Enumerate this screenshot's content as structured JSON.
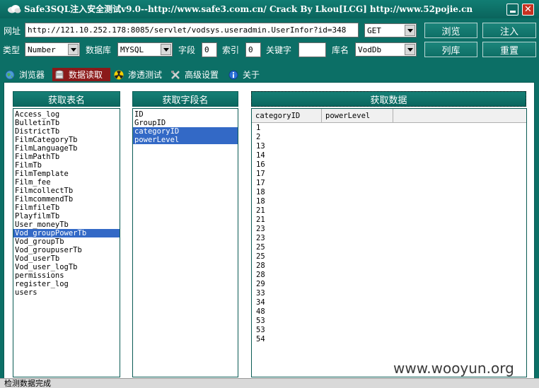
{
  "window": {
    "title": "Safe3SQL注入安全测试v9.0--http://www.safe3.com.cn/   Crack By Lkou[LCG]  http://www.52pojie.cn"
  },
  "toolbar": {
    "url_label": "网址",
    "url_value": "http://121.10.252.178:8085/servlet/vodsys.useradmin.UserInfor?id=348",
    "method": "GET",
    "browse_button": "浏览",
    "inject_button": "注入",
    "type_label": "类型",
    "type_value": "Number",
    "db_label": "数据库",
    "db_value": "MYSQL",
    "field_label": "字段",
    "field_value": "0",
    "index_label": "索引",
    "index_value": "0",
    "keyword_label": "关键字",
    "keyword_value": "",
    "libname_label": "库名",
    "libname_value": "VodDb",
    "list_db_button": "列库",
    "reset_button": "重置"
  },
  "tabs": [
    {
      "label": "浏览器",
      "icon": "globe-icon",
      "active": false
    },
    {
      "label": "数据读取",
      "icon": "database-icon",
      "active": true
    },
    {
      "label": "渗透测试",
      "icon": "radiation-icon",
      "active": false
    },
    {
      "label": "高级设置",
      "icon": "tools-icon",
      "active": false
    },
    {
      "label": "关于",
      "icon": "info-icon",
      "active": false
    }
  ],
  "panels": {
    "tables_header": "获取表名",
    "fields_header": "获取字段名",
    "data_header": "获取数据"
  },
  "tables": [
    {
      "name": "Access_log",
      "selected": false
    },
    {
      "name": "BulletinTb",
      "selected": false
    },
    {
      "name": "DistrictTb",
      "selected": false
    },
    {
      "name": "FilmCategoryTb",
      "selected": false
    },
    {
      "name": "FilmLanguageTb",
      "selected": false
    },
    {
      "name": "FilmPathTb",
      "selected": false
    },
    {
      "name": "FilmTb",
      "selected": false
    },
    {
      "name": "FilmTemplate",
      "selected": false
    },
    {
      "name": "Film_fee",
      "selected": false
    },
    {
      "name": "FilmcollectTb",
      "selected": false
    },
    {
      "name": "FilmcommendTb",
      "selected": false
    },
    {
      "name": "FilmfileTb",
      "selected": false
    },
    {
      "name": "PlayfilmTb",
      "selected": false
    },
    {
      "name": "User_moneyTb",
      "selected": false
    },
    {
      "name": "Vod_groupPowerTb",
      "selected": true
    },
    {
      "name": "Vod_groupTb",
      "selected": false
    },
    {
      "name": "Vod_groupuserTb",
      "selected": false
    },
    {
      "name": "Vod_userTb",
      "selected": false
    },
    {
      "name": "Vod_user_logTb",
      "selected": false
    },
    {
      "name": "permissions",
      "selected": false
    },
    {
      "name": "register_log",
      "selected": false
    },
    {
      "name": "users",
      "selected": false
    }
  ],
  "fields": [
    {
      "name": "ID",
      "selected": false
    },
    {
      "name": "GroupID",
      "selected": false
    },
    {
      "name": "categoryID",
      "selected": true
    },
    {
      "name": "powerLevel",
      "selected": true
    }
  ],
  "data_grid": {
    "columns": [
      "categoryID",
      "powerLevel"
    ],
    "rows": [
      "1",
      "2",
      "13",
      "14",
      "16",
      "17",
      "17",
      "18",
      "18",
      "21",
      "21",
      "23",
      "23",
      "25",
      "25",
      "28",
      "28",
      "29",
      "33",
      "34",
      "48",
      "53",
      "53",
      "54"
    ]
  },
  "status": "检测数据完成",
  "watermark": "www.wooyun.org",
  "colors": {
    "theme": "#0c6f66",
    "active_tab": "#8b1a1a",
    "selection": "#3369c6"
  }
}
